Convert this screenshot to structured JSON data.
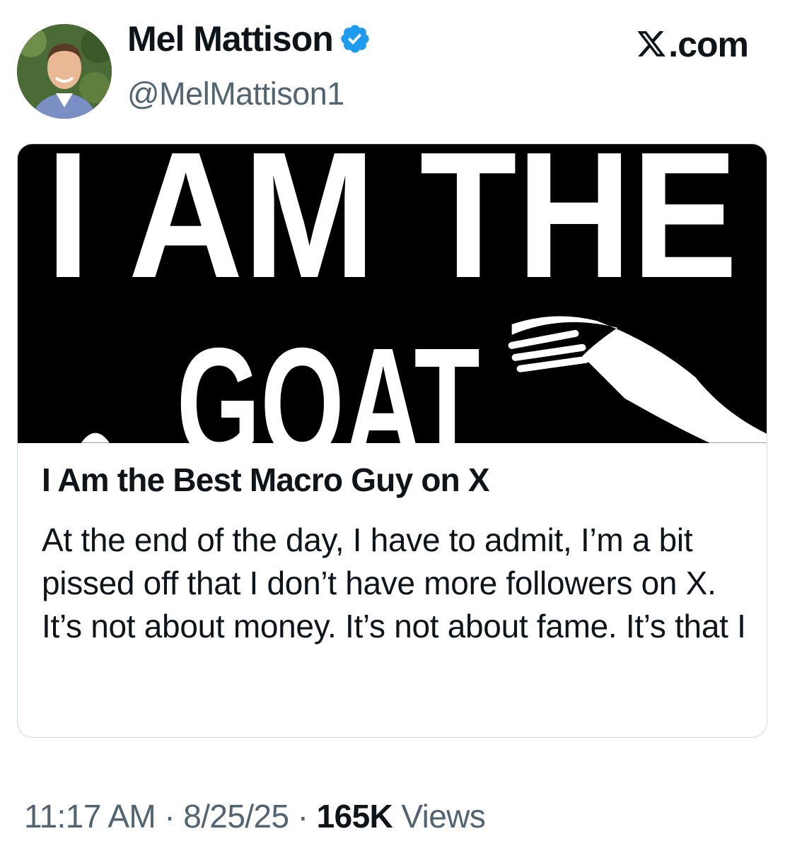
{
  "author": {
    "name": "Mel Mattison",
    "handle": "@MelMattison1",
    "verified_color": "#1d9bf0"
  },
  "site": {
    "label": ".com"
  },
  "card": {
    "image_text_line1": "I AM THE",
    "image_text_line2": "GOAT",
    "title": "I Am the Best Macro Guy on X",
    "description": "At the end of the day, I have to admit, I’m a bit pissed off that I don’t have more followers on X. It’s not about money. It’s not about fame. It’s that I"
  },
  "meta": {
    "time": "11:17 AM",
    "separator": " · ",
    "date": "8/25/25",
    "views_count": "165K",
    "views_label": "Views"
  },
  "colors": {
    "text": "#0f1419",
    "muted": "#536471",
    "border": "#cfd9de"
  }
}
